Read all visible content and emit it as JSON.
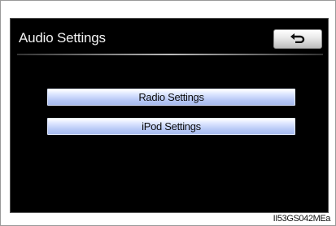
{
  "screen": {
    "title": "Audio Settings",
    "back_icon": "return-arrow-icon"
  },
  "menu": {
    "items": [
      {
        "label": "Radio Settings"
      },
      {
        "label": "iPod Settings"
      }
    ]
  },
  "figure_code": "II53GS042MEa",
  "colors": {
    "screen_bg": "#000000",
    "button_blue": "#b7c8f6",
    "title_text": "#f2f2f2"
  }
}
